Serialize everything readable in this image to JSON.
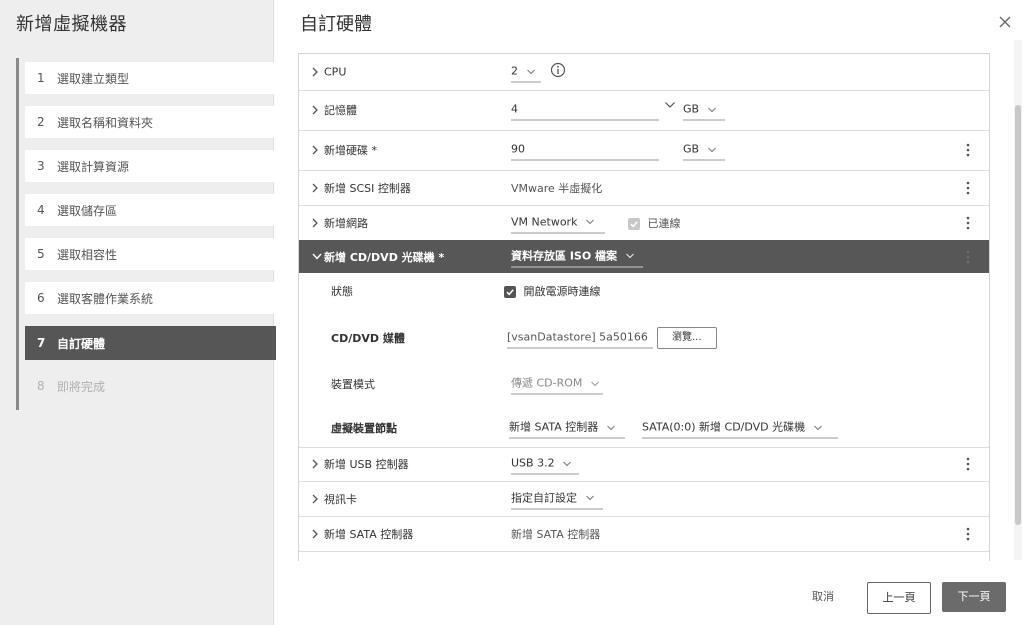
{
  "sidebar": {
    "title": "新增虛擬機器",
    "steps": [
      {
        "num": "1",
        "label": "選取建立類型"
      },
      {
        "num": "2",
        "label": "選取名稱和資料夾"
      },
      {
        "num": "3",
        "label": "選取計算資源"
      },
      {
        "num": "4",
        "label": "選取儲存區"
      },
      {
        "num": "5",
        "label": "選取相容性"
      },
      {
        "num": "6",
        "label": "選取客體作業系統"
      },
      {
        "num": "7",
        "label": "自訂硬體"
      },
      {
        "num": "8",
        "label": "即將完成"
      }
    ],
    "active_step": "7"
  },
  "main": {
    "title": "自訂硬體",
    "close_icon": "close-icon"
  },
  "hardware": {
    "cpu": {
      "label": "CPU",
      "value": "2",
      "info_icon": "info-icon"
    },
    "memory": {
      "label": "記憶體",
      "value": "4",
      "unit": "GB"
    },
    "disk": {
      "label": "新增硬碟 *",
      "value": "90",
      "unit": "GB"
    },
    "scsi": {
      "label": "新增 SCSI 控制器",
      "value": "VMware 半虛擬化"
    },
    "network": {
      "label": "新增網路",
      "value": "VM Network",
      "connected_label": "已連線"
    },
    "cdrom": {
      "label": "新增 CD/DVD 光碟機 *",
      "value": "資料存放區 ISO 檔案",
      "status_label": "狀態",
      "status_check": "開啟電源時連線",
      "media_label": "CD/DVD 媒體",
      "media_value": "[vsanDatastore] 5a50166",
      "browse_label": "瀏覽...",
      "mode_label": "裝置模式",
      "mode_value": "傳遞 CD-ROM",
      "node_label": "虛擬裝置節點",
      "node_controller": "新增 SATA 控制器",
      "node_value": "SATA(0:0) 新增 CD/DVD 光碟機"
    },
    "usb": {
      "label": "新增 USB 控制器",
      "value": "USB 3.2"
    },
    "video": {
      "label": "視訊卡",
      "value": "指定自訂設定"
    },
    "sata": {
      "label": "新增 SATA 控制器",
      "value": "新增 SATA 控制器"
    }
  },
  "footer": {
    "cancel": "取消",
    "back": "上一頁",
    "next": "下一頁"
  },
  "colors": {
    "active_step_bg": "#565656",
    "header_row_bg": "#575757",
    "next_button_bg": "#6b6b6b"
  }
}
